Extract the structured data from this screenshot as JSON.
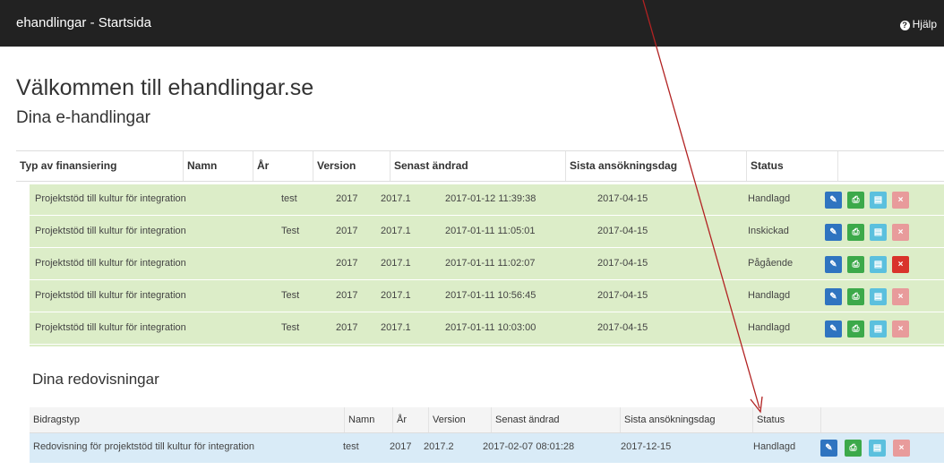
{
  "topbar": {
    "title": "ehandlingar - Startsida",
    "help_label": "Hjälp",
    "help_icon": "?"
  },
  "welcome": "Välkommen till ehandlingar.se",
  "ehandlingar": {
    "heading": "Dina e-handlingar",
    "columns": [
      "Typ av finansiering",
      "Namn",
      "År",
      "Version",
      "Senast ändrad",
      "Sista ansökningsdag",
      "Status"
    ],
    "rows": [
      {
        "typ": "Projektstöd till kultur för integration",
        "namn": "test",
        "ar": "2017",
        "version": "2017.1",
        "senast": "2017-01-12 11:39:38",
        "sista": "2017-04-15",
        "status": "Handlagd"
      },
      {
        "typ": "Projektstöd till kultur för integration",
        "namn": "Test",
        "ar": "2017",
        "version": "2017.1",
        "senast": "2017-01-11 11:05:01",
        "sista": "2017-04-15",
        "status": "Inskickad"
      },
      {
        "typ": "Projektstöd till kultur för integration",
        "namn": "",
        "ar": "2017",
        "version": "2017.1",
        "senast": "2017-01-11 11:02:07",
        "sista": "2017-04-15",
        "status": "Pågående"
      },
      {
        "typ": "Projektstöd till kultur för integration",
        "namn": "Test",
        "ar": "2017",
        "version": "2017.1",
        "senast": "2017-01-11 10:56:45",
        "sista": "2017-04-15",
        "status": "Handlagd"
      },
      {
        "typ": "Projektstöd till kultur för integration",
        "namn": "Test",
        "ar": "2017",
        "version": "2017.1",
        "senast": "2017-01-11 10:03:00",
        "sista": "2017-04-15",
        "status": "Handlagd"
      }
    ]
  },
  "redovisningar": {
    "heading": "Dina redovisningar",
    "columns": [
      "Bidragstyp",
      "Namn",
      "År",
      "Version",
      "Senast ändrad",
      "Sista ansökningsdag",
      "Status"
    ],
    "rows": [
      {
        "typ": "Redovisning för projektstöd till kultur för integration",
        "namn": "test",
        "ar": "2017",
        "version": "2017.2",
        "senast": "2017-02-07 08:01:28",
        "sista": "2017-12-15",
        "status": "Handlagd"
      }
    ]
  },
  "icons": {
    "edit": "pencil-icon",
    "print": "print-icon",
    "view": "document-icon",
    "delete": "delete-icon"
  },
  "colors": {
    "topbar": "#222222",
    "row_green": "#dcedc8",
    "row_blue": "#d9ebf7",
    "edit": "#2f74c0",
    "print": "#3ca94a",
    "view": "#5bc0de",
    "delete_disabled": "#e89b9b",
    "delete_active": "#d9332b",
    "annotation_arrow": "#b22222"
  }
}
